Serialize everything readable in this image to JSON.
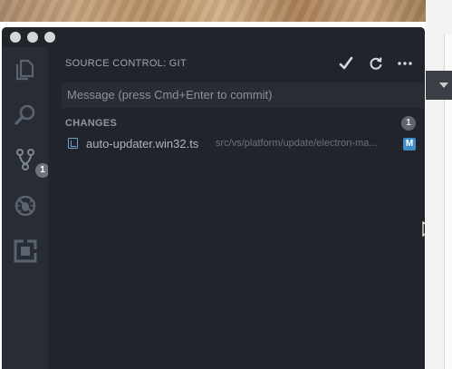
{
  "sidebar": {
    "title": "SOURCE CONTROL: GIT",
    "commit_placeholder": "Message (press Cmd+Enter to commit)",
    "changes_header": "CHANGES",
    "changes_count": "1",
    "files": [
      {
        "name": "auto-updater.win32.ts",
        "path": "src/vs/platform/update/electron-ma...",
        "status": "M"
      }
    ]
  },
  "activity_bar": {
    "items": [
      {
        "icon": "files-icon"
      },
      {
        "icon": "search-icon"
      },
      {
        "icon": "source-control-icon",
        "badge": "1"
      },
      {
        "icon": "debug-icon"
      },
      {
        "icon": "extensions-icon"
      }
    ]
  },
  "toolbar": {
    "actions": [
      "commit-check-icon",
      "refresh-icon",
      "more-icon"
    ]
  },
  "colors": {
    "window_bg": "#21252b",
    "activity_bg": "#282c34",
    "status_modified": "#3d8fc6",
    "text_primary": "#aeb4bd",
    "text_muted": "#6b717b"
  }
}
